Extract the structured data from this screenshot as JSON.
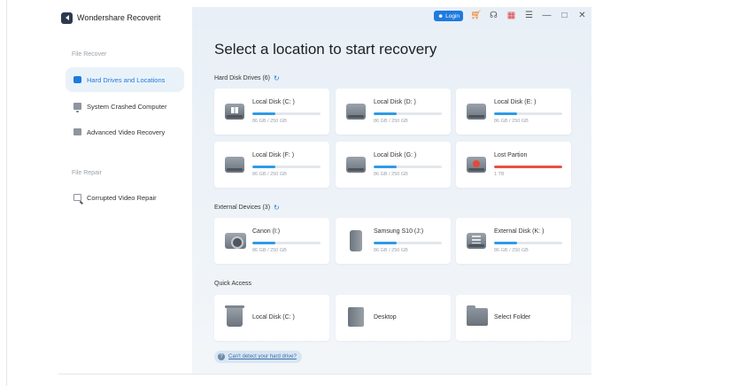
{
  "app": {
    "name": "Wondershare Recoverit"
  },
  "titlebar": {
    "login_label": "Login"
  },
  "sidebar": {
    "file_recover_heading": "File Recover",
    "file_repair_heading": "File Repair",
    "items": [
      {
        "label": "Hard Drives and Locations",
        "icon": "hard-drive-icon",
        "active": true
      },
      {
        "label": "System Crashed Computer",
        "icon": "monitor-icon",
        "active": false
      },
      {
        "label": "Advanced Video Recovery",
        "icon": "video-icon",
        "active": false
      },
      {
        "label": "Corrupted Video Repair",
        "icon": "video-repair-icon",
        "active": false
      }
    ]
  },
  "main": {
    "title": "Select a location to start recovery",
    "hard_disk_heading": "Hard Disk Drives (6)",
    "external_heading": "External Devices (3)",
    "quick_access_heading": "Quick Access",
    "help_link": "Can't detect your hard drive?",
    "hard_disks": [
      {
        "name": "Local Disk (C: )",
        "size": "86 GB / 250 GB",
        "used": 0.34,
        "icon": "windows-drive-icon"
      },
      {
        "name": "Local Disk (D: )",
        "size": "86 GB / 250 GB",
        "used": 0.34,
        "icon": "hard-drive-icon"
      },
      {
        "name": "Local Disk (E: )",
        "size": "86 GB / 250 GB",
        "used": 0.34,
        "icon": "hard-drive-icon"
      },
      {
        "name": "Local Disk (F: )",
        "size": "86 GB / 250 GB",
        "used": 0.34,
        "icon": "hard-drive-icon"
      },
      {
        "name": "Local Disk (G: )",
        "size": "86 GB / 250 GB",
        "used": 0.34,
        "icon": "hard-drive-icon"
      },
      {
        "name": "Lost Partion",
        "size": "1 TB",
        "used": 1.0,
        "icon": "lost-partition-icon"
      }
    ],
    "external_devices": [
      {
        "name": "Canon (I:)",
        "size": "86 GB / 250 GB",
        "used": 0.34,
        "icon": "camera-icon"
      },
      {
        "name": "Samsung S10  (J:)",
        "size": "86 GB / 250 GB",
        "used": 0.34,
        "icon": "phone-icon"
      },
      {
        "name": "External Disk (K: )",
        "size": "86 GB / 250 GB",
        "used": 0.34,
        "icon": "external-drive-icon"
      }
    ],
    "quick_access": [
      {
        "name": "Local Disk (C: )",
        "icon": "recycle-bin-icon"
      },
      {
        "name": "Desktop",
        "icon": "desktop-icon"
      },
      {
        "name": "Select Folder",
        "icon": "folder-icon"
      }
    ]
  },
  "colors": {
    "accent": "#1f7ae0",
    "progress": "#2f9ae6",
    "lost": "#e8503f"
  }
}
